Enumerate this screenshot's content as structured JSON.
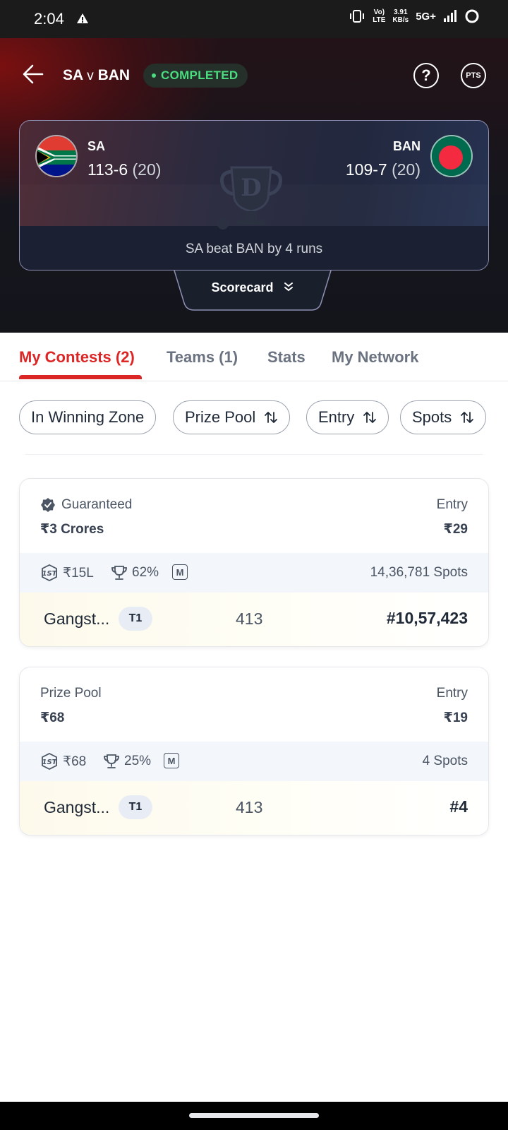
{
  "status_bar": {
    "time": "2:04",
    "network_top": "Vo)",
    "network_bottom": "LTE",
    "speed_top": "3.91",
    "speed_bottom": "KB/s",
    "network_type": "5G+"
  },
  "header": {
    "team_a_short": "SA",
    "versus": "v",
    "team_b_short": "BAN",
    "status": "COMPLETED",
    "help_icon": "question-circle-icon",
    "pts_label": "PTS"
  },
  "scorecard": {
    "team_a": {
      "name": "SA",
      "runs": "113-6",
      "overs": "(20)",
      "flag": "south-africa-flag"
    },
    "team_b": {
      "name": "BAN",
      "runs": "109-7",
      "overs": "(20)",
      "flag": "bangladesh-flag"
    },
    "result": "SA beat BAN by 4 runs",
    "toggle_label": "Scorecard"
  },
  "tabs": [
    {
      "label": "My Contests (2)",
      "active": true
    },
    {
      "label": "Teams (1)",
      "active": false
    },
    {
      "label": "Stats",
      "active": false
    },
    {
      "label": "My Network",
      "active": false
    }
  ],
  "filters": [
    {
      "label": "In Winning Zone",
      "sortable": false
    },
    {
      "label": "Prize Pool",
      "sortable": true
    },
    {
      "label": "Entry",
      "sortable": true
    },
    {
      "label": "Spots",
      "sortable": true
    }
  ],
  "contests": [
    {
      "label": "Guaranteed",
      "prize": "₹3 Crores",
      "entry_label": "Entry",
      "entry": "₹29",
      "first_prize": "₹15L",
      "winners_pct": "62%",
      "multi_badge": "M",
      "spots": "14,36,781 Spots",
      "team_name": "Gangst...",
      "team_tag": "T1",
      "points": "413",
      "rank": "#10,57,423"
    },
    {
      "label": "Prize Pool",
      "prize": "₹68",
      "entry_label": "Entry",
      "entry": "₹19",
      "first_prize": "₹68",
      "winners_pct": "25%",
      "multi_badge": "M",
      "spots": "4 Spots",
      "team_name": "Gangst...",
      "team_tag": "T1",
      "points": "413",
      "rank": "#4"
    }
  ]
}
